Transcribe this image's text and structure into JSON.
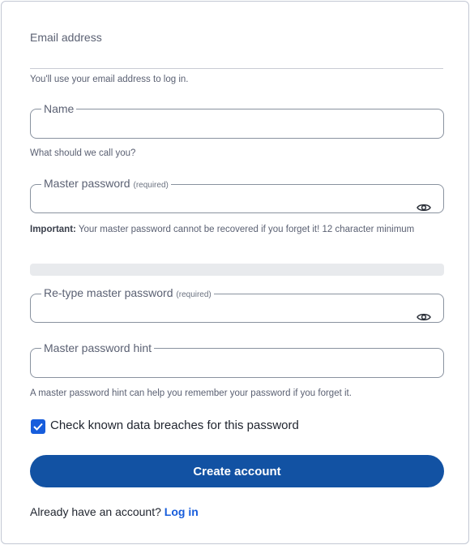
{
  "email": {
    "label": "Email address",
    "hint": "You'll use your email address to log in."
  },
  "name": {
    "label": "Name",
    "value": "",
    "hint": "What should we call you?"
  },
  "master_password": {
    "label": "Master password",
    "required_tag": "(required)",
    "value": "",
    "important_label": "Important:",
    "important_text": " Your master password cannot be recovered if you forget it! 12 character minimum",
    "toggle_icon": "eye-icon"
  },
  "password_strength": {
    "level": 0
  },
  "retype_password": {
    "label": "Re-type master password",
    "required_tag": "(required)",
    "value": "",
    "toggle_icon": "eye-icon"
  },
  "password_hint": {
    "label": "Master password hint",
    "value": "",
    "hint": "A master password hint can help you remember your password if you forget it."
  },
  "breach_check": {
    "label": "Check known data breaches for this password",
    "checked": true
  },
  "actions": {
    "create_account_label": "Create account"
  },
  "footer": {
    "prompt": "Already have an account?",
    "login_link": "Log in"
  },
  "colors": {
    "primary": "#1252a3",
    "accent": "#175ddc",
    "border": "#89929f"
  }
}
